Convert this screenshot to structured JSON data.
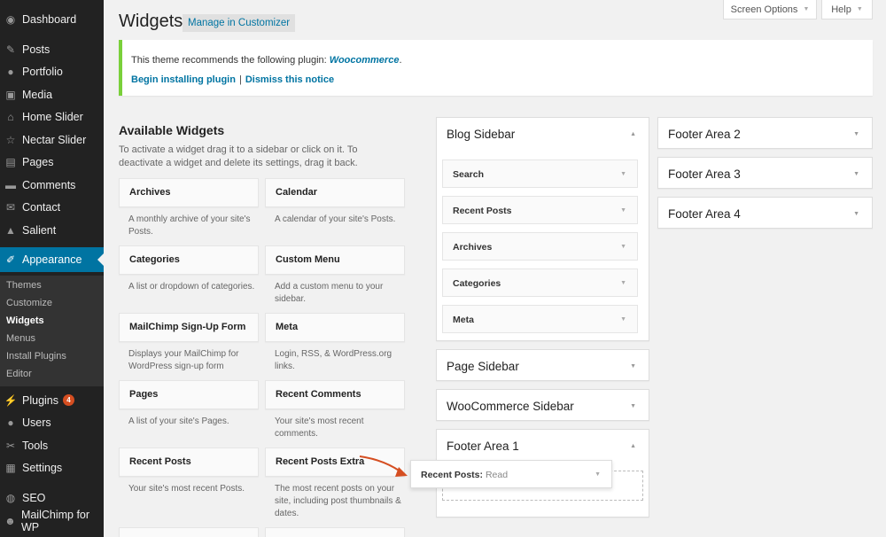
{
  "admin_menu": {
    "items": [
      {
        "label": "Dashboard",
        "icon": "dashboard-icon"
      },
      {
        "label": "Posts",
        "icon": "pin-icon"
      },
      {
        "label": "Portfolio",
        "icon": "portfolio-icon"
      },
      {
        "label": "Media",
        "icon": "media-icon"
      },
      {
        "label": "Home Slider",
        "icon": "home-icon"
      },
      {
        "label": "Nectar Slider",
        "icon": "star-icon"
      },
      {
        "label": "Pages",
        "icon": "pages-icon"
      },
      {
        "label": "Comments",
        "icon": "comment-icon"
      },
      {
        "label": "Contact",
        "icon": "mail-icon"
      },
      {
        "label": "Salient",
        "icon": "mountain-icon"
      },
      {
        "label": "Appearance",
        "icon": "brush-icon"
      },
      {
        "label": "Plugins",
        "icon": "plug-icon",
        "badge": "4"
      },
      {
        "label": "Users",
        "icon": "user-icon"
      },
      {
        "label": "Tools",
        "icon": "wrench-icon"
      },
      {
        "label": "Settings",
        "icon": "settings-icon"
      },
      {
        "label": "SEO",
        "icon": "seo-icon"
      },
      {
        "label": "MailChimp for WP",
        "icon": "mailchimp-icon"
      }
    ],
    "submenu": [
      "Themes",
      "Customize",
      "Widgets",
      "Menus",
      "Install Plugins",
      "Editor"
    ],
    "active_color": "#0074a2"
  },
  "header": {
    "title": "Widgets",
    "customizer_button": "Manage in Customizer",
    "screen_options": "Screen Options",
    "help": "Help"
  },
  "notice": {
    "message": "This theme recommends the following plugin: ",
    "plugin": "Woocommerce",
    "period": ".",
    "begin_link": "Begin installing plugin",
    "separator": "|",
    "dismiss_link": "Dismiss this notice",
    "accent_color": "#7ad03a"
  },
  "available": {
    "title": "Available Widgets",
    "description": "To activate a widget drag it to a sidebar or click on it. To deactivate a widget and delete its settings, drag it back.",
    "widgets": [
      {
        "name": "Archives",
        "desc": "A monthly archive of your site's Posts."
      },
      {
        "name": "Calendar",
        "desc": "A calendar of your site's Posts."
      },
      {
        "name": "Categories",
        "desc": "A list or dropdown of categories."
      },
      {
        "name": "Custom Menu",
        "desc": "Add a custom menu to your sidebar."
      },
      {
        "name": "MailChimp Sign-Up Form",
        "desc": "Displays your MailChimp for WordPress sign-up form"
      },
      {
        "name": "Meta",
        "desc": "Login, RSS, & WordPress.org links."
      },
      {
        "name": "Pages",
        "desc": "A list of your site's Pages."
      },
      {
        "name": "Recent Comments",
        "desc": "Your site's most recent comments."
      },
      {
        "name": "Recent Posts",
        "desc": "Your site's most recent Posts."
      },
      {
        "name": "Recent Posts Extra",
        "desc": "The most recent posts on your site, including post thumbnails & dates."
      }
    ]
  },
  "sidebars": {
    "blog": {
      "name": "Blog Sidebar",
      "widgets": [
        "Search",
        "Recent Posts",
        "Archives",
        "Categories",
        "Meta"
      ]
    },
    "page": {
      "name": "Page Sidebar"
    },
    "woocommerce": {
      "name": "WooCommerce Sidebar"
    },
    "footer1": {
      "name": "Footer Area 1"
    },
    "footer2": {
      "name": "Footer Area 2"
    },
    "footer3": {
      "name": "Footer Area 3"
    },
    "footer4": {
      "name": "Footer Area 4"
    }
  },
  "dragging": {
    "title": "Recent Posts",
    "colon": ":",
    "suffix": " Read",
    "arrow_color": "#d54e21"
  }
}
